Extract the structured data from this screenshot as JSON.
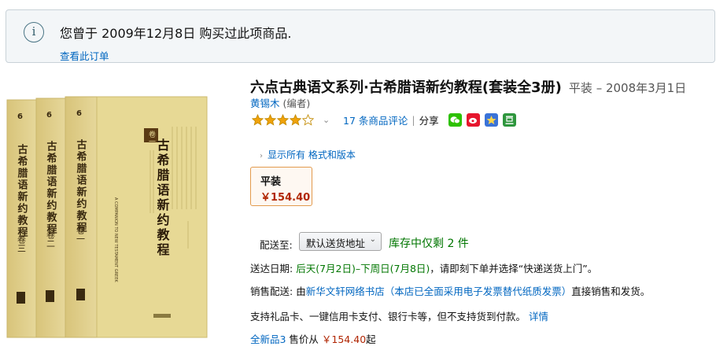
{
  "notice": {
    "text": "您曾于 2009年12月8日 购买过此项商品.",
    "link": "查看此订单"
  },
  "product": {
    "title": "六点古典语文系列·古希腊语新约教程(套装全3册)",
    "binding_date": "平装 – 2008年3月1日",
    "author": "黄锡木",
    "author_role": "(编者)",
    "rating": 4,
    "review_link": "17 条商品评论",
    "separator": "|",
    "share_label": "分享",
    "formats_link": "显示所有 格式和版本",
    "format_name": "平装",
    "format_price": "￥154.40"
  },
  "cover": {
    "side_titles": [
      "古希腊语新约教程",
      "古希腊语新约教程",
      "古希腊语新约教程"
    ],
    "volume_labels": [
      "卷三",
      "卷二",
      "卷一"
    ],
    "spine_number": "6",
    "front_title": "古希腊语新约教程",
    "front_volume": "卷一",
    "front_english": "A COMPANION TO NEW TESTAMENT GREEK"
  },
  "shipping": {
    "label": "配送至:",
    "select_value": "默认送货地址",
    "stock": "库存中仅剩 2 件"
  },
  "delivery": {
    "label": "送达日期:",
    "dates": "后天(7月2日)–下周日(7月8日)",
    "suffix": "，请即刻下单并选择“快递送货上门”。"
  },
  "seller": {
    "label": "销售配送:",
    "prefix": "由",
    "store": "新华文轩网络书店（本店已全面采用电子发票替代纸质发票）",
    "suffix": "直接销售和发货。"
  },
  "payment": {
    "text": "支持礼品卡、一键信用卡支付、银行卡等，但不支持货到付款。",
    "details_link": "详情"
  },
  "offers": {
    "link": "全新品3",
    "text": " 售价从 ",
    "price": "￥154.40",
    "suffix": "起"
  },
  "colors": {
    "link": "#0066c0",
    "price": "#b12704",
    "stock": "#007600",
    "star": "#f0a20a",
    "cover_gold": "#e3d38e"
  }
}
